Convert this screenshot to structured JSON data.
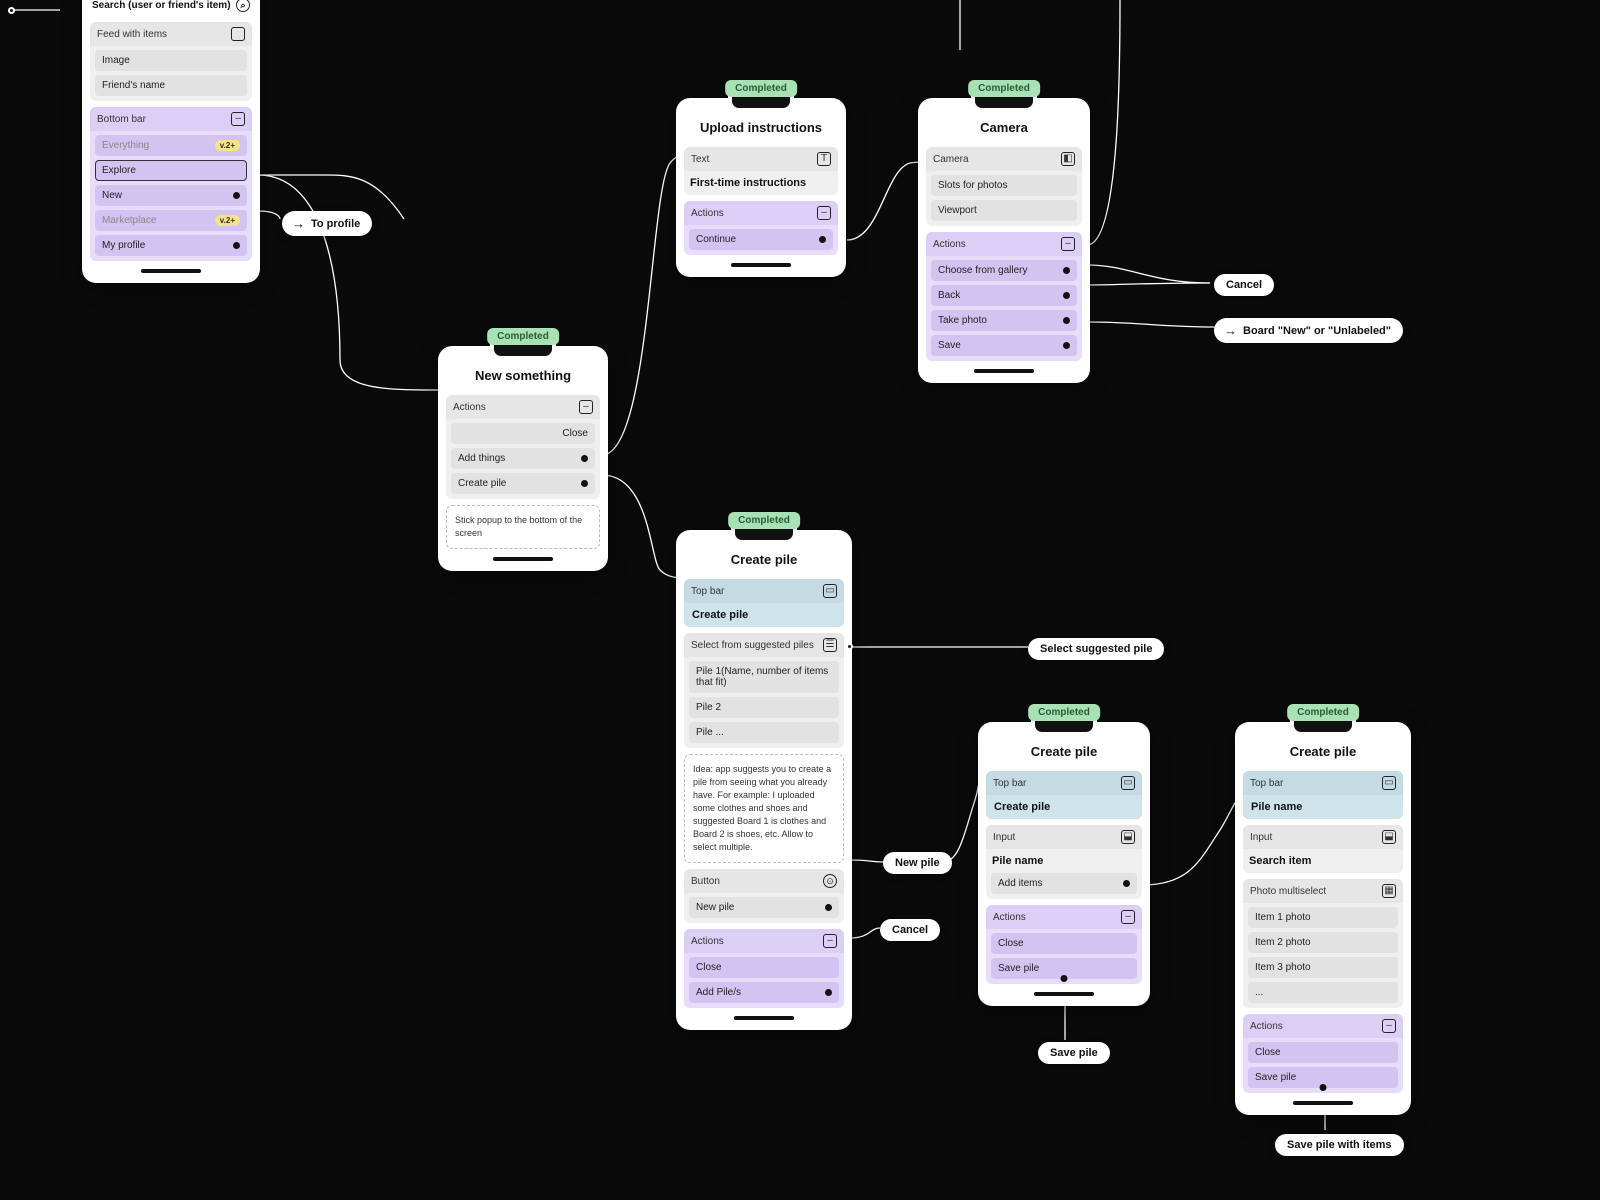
{
  "status": {
    "completed": "Completed"
  },
  "nav": {
    "to_profile": "To profile",
    "new_pile": "New pile",
    "cancel": "Cancel",
    "board_new_unlabeled": "Board \"New\" or \"Unlabeled\"",
    "select_suggested_pile": "Select suggested pile",
    "save_pile": "Save pile",
    "save_pile_with_items": "Save pile with items"
  },
  "badge_v2": "v.2+",
  "phone_feed": {
    "search_label": "Search (user or friend's item)",
    "feed_label": "Feed with items",
    "feed_items": [
      "Image",
      "Friend's name"
    ],
    "bottombar_label": "Bottom bar",
    "bottombar_items": [
      "Everything",
      "Explore",
      "New",
      "Marketplace",
      "My profile"
    ],
    "badge_indices": [
      0,
      3
    ],
    "selected_index": 1
  },
  "phone_new_something": {
    "title": "New something",
    "actions_label": "Actions",
    "actions": [
      "Close",
      "Add things",
      "Create pile"
    ],
    "note": "Stick popup to the bottom of the screen"
  },
  "phone_upload": {
    "title": "Upload instructions",
    "text_label": "Text",
    "text_value": "First-time instructions",
    "actions_label": "Actions",
    "actions": [
      "Continue"
    ]
  },
  "phone_camera": {
    "title": "Camera",
    "camera_label": "Camera",
    "camera_items": [
      "Slots for photos",
      "Viewport"
    ],
    "actions_label": "Actions",
    "actions": [
      "Choose from gallery",
      "Back",
      "Take photo",
      "Save"
    ]
  },
  "phone_create_pile_a": {
    "title": "Create pile",
    "top_bar_label": "Top bar",
    "top_bar_value": "Create pile",
    "suggested_label": "Select from suggested piles",
    "suggested_items": [
      "Pile 1(Name, number of items that fit)",
      "Pile 2",
      "Pile ..."
    ],
    "idea": "Idea: app suggests you to create a pile from seeing what you already have. For example: I uploaded some clothes and shoes and suggested Board 1 is clothes and Board 2 is shoes, etc. Allow to select multiple.",
    "button_label": "Button",
    "button_value": "New pile",
    "actions_label": "Actions",
    "actions": [
      "Close",
      "Add Pile/s"
    ]
  },
  "phone_create_pile_b": {
    "title": "Create pile",
    "top_bar_label": "Top bar",
    "top_bar_value": "Create pile",
    "input_label": "Input",
    "input_value": "Pile name",
    "add_items": "Add items",
    "actions_label": "Actions",
    "actions": [
      "Close",
      "Save pile"
    ]
  },
  "phone_create_pile_c": {
    "title": "Create pile",
    "top_bar_label": "Top bar",
    "top_bar_value": "Pile name",
    "input_label": "Input",
    "input_value": "Search item",
    "multi_label": "Photo multiselect",
    "multi_items": [
      "Item 1 photo",
      "Item 2 photo",
      "Item 3 photo",
      "..."
    ],
    "actions_label": "Actions",
    "actions": [
      "Close",
      "Save pile"
    ]
  }
}
